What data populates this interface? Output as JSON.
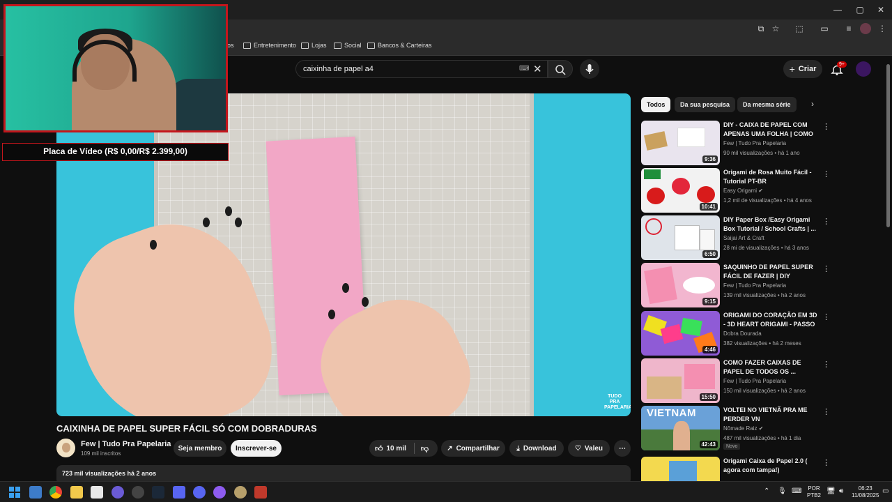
{
  "browser": {
    "bookmarks": [
      {
        "label": "os"
      },
      {
        "label": "Entretenimento"
      },
      {
        "label": "Lojas"
      },
      {
        "label": "Social"
      },
      {
        "label": "Bancos & Carteiras"
      }
    ]
  },
  "youtube": {
    "search_value": "caixinha de papel a4",
    "create_label": "Criar",
    "notification_count": "9+"
  },
  "overlay": {
    "caption": "Placa de Vídeo (R$ 0,00/R$ 2.399,00)"
  },
  "video": {
    "watermark": "TUDO PRA PAPELARIA",
    "title": "CAIXINHA DE PAPEL SUPER FÁCIL SÓ COM DOBRADURAS",
    "channel": "Few | Tudo Pra Papelaria",
    "subscribers": "109 mil inscritos",
    "member_label": "Seja membro",
    "subscribe_label": "Inscrever-se",
    "likes": "10 mil",
    "share_label": "Compartilhar",
    "download_label": "Download",
    "thanks_label": "Valeu",
    "views_date": "723 mil visualizações  há 2 anos"
  },
  "chips": [
    "Todos",
    "Da sua pesquisa",
    "Da mesma série"
  ],
  "recommendations": [
    {
      "title": "DIY - CAIXA DE PAPEL COM APENAS UMA FOLHA | COMO ...",
      "channel": "Few | Tudo Pra Papelaria",
      "meta": "90 mil visualizações • há 1 ano",
      "duration": "9:36",
      "color": "#e9e4ee"
    },
    {
      "title": "Origami de Rosa Muito Fácil - Tutorial PT-BR",
      "channel": "Easy Origami ✔",
      "meta": "1,2 mil de visualizações • há 4 anos",
      "duration": "10:41",
      "color": "#f2f2f2"
    },
    {
      "title": "DIY Paper Box /Easy Origami Box Tutorial / School Crafts | ...",
      "channel": "Saijai Art & Craft",
      "meta": "28 mi de visualizações • há 3 anos",
      "duration": "6:50",
      "color": "#dfe4ea"
    },
    {
      "title": "SAQUINHO DE PAPEL SUPER FÁCIL DE FAZER | DIY",
      "channel": "Few | Tudo Pra Papelaria",
      "meta": "139 mil visualizações • há 2 anos",
      "duration": "9:15",
      "color": "#f2b6cf"
    },
    {
      "title": "ORIGAMI DO CORAÇÃO EM 3D - 3D HEART ORIGAMI - PASSO ...",
      "channel": "Dobra Dourada",
      "meta": "382 visualizações • há 2 meses",
      "duration": "4:46",
      "color": "#8f5bd6"
    },
    {
      "title": "COMO FAZER CAIXAS DE PAPEL DE TODOS OS ...",
      "channel": "Few | Tudo Pra Papelaria",
      "meta": "150 mil visualizações • há 2 anos",
      "duration": "15:50",
      "color": "#efb6cb"
    },
    {
      "title": "VOLTEI NO VIETNÃ PRA ME PERDER VN",
      "channel": "Nômade Raiz ✔",
      "meta": "487 mil visualizações • há 1 dia",
      "duration": "42:43",
      "badge": "Novo",
      "color": "#6aa1d8"
    },
    {
      "title": "Origami Caixa de Papel 2.0 ( agora com tampa!)",
      "channel": "",
      "meta": "",
      "duration": "",
      "color": "#f3d94f"
    }
  ],
  "thumb_text": {
    "vietnam": "VIETNAM"
  },
  "taskbar": {
    "lang": "POR",
    "layout": "PTB2",
    "time": "06:23",
    "date": "11/08/2025"
  }
}
